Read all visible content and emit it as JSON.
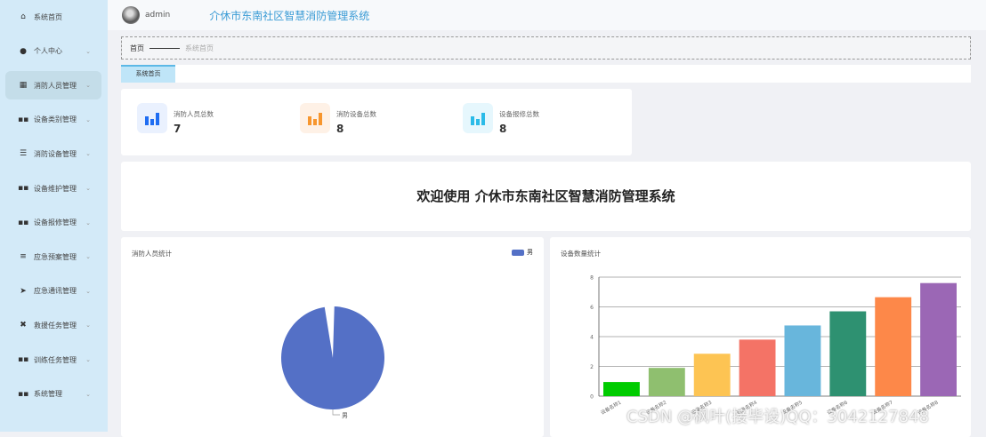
{
  "header": {
    "username": "admin",
    "title": "介休市东南社区智慧消防管理系统"
  },
  "sidebar": {
    "items": [
      {
        "label": "系统首页",
        "icon": "home-icon",
        "glyph": "⌂",
        "chev": false
      },
      {
        "label": "个人中心",
        "icon": "user-icon",
        "glyph": "●",
        "chev": true
      },
      {
        "label": "消防人员管理",
        "icon": "grid-icon",
        "glyph": "▦",
        "chev": true
      },
      {
        "label": "设备类别管理",
        "icon": "apps-icon",
        "glyph": "▪▪",
        "chev": true
      },
      {
        "label": "消防设备管理",
        "icon": "list-icon",
        "glyph": "☰",
        "chev": true
      },
      {
        "label": "设备维护管理",
        "icon": "apps-icon",
        "glyph": "▪▪",
        "chev": true
      },
      {
        "label": "设备报修管理",
        "icon": "apps-icon",
        "glyph": "▪▪",
        "chev": true
      },
      {
        "label": "应急预案管理",
        "icon": "sliders-icon",
        "glyph": "≡",
        "chev": true
      },
      {
        "label": "应急通讯管理",
        "icon": "send-icon",
        "glyph": "➤",
        "chev": true
      },
      {
        "label": "救援任务管理",
        "icon": "rescue-icon",
        "glyph": "✖",
        "chev": true
      },
      {
        "label": "训练任务管理",
        "icon": "apps-icon",
        "glyph": "▪▪",
        "chev": true
      },
      {
        "label": "系统管理",
        "icon": "apps-icon",
        "glyph": "▪▪",
        "chev": true
      }
    ]
  },
  "breadcrumb": {
    "home": "首页",
    "current": "系统首页"
  },
  "tabs": [
    "系统首页"
  ],
  "stats": [
    {
      "label": "消防人员总数",
      "value": "7",
      "color": "#1f6df2",
      "bg": "#eaf1fe"
    },
    {
      "label": "消防设备总数",
      "value": "8",
      "color": "#f7962e",
      "bg": "#fef1e6"
    },
    {
      "label": "设备报修总数",
      "value": "8",
      "color": "#2bbbe8",
      "bg": "#e6f7fd"
    }
  ],
  "welcome": "欢迎使用 介休市东南社区智慧消防管理系统",
  "watermark": "CSDN @枫叶(接毕设)QQ：3042127848",
  "chart_data": [
    {
      "type": "pie",
      "title": "消防人员统计",
      "legend": [
        "男"
      ],
      "slices": [
        {
          "name": "男",
          "value": 7
        }
      ],
      "color": "#5470c6"
    },
    {
      "type": "bar",
      "title": "设备数量统计",
      "categories": [
        "设备名称1",
        "设备名称2",
        "设备名称3",
        "设备名称4",
        "设备名称5",
        "设备名称6",
        "设备名称7",
        "设备名称8"
      ],
      "values": [
        0.95,
        1.9,
        2.85,
        3.8,
        4.75,
        5.7,
        6.65,
        7.6
      ],
      "colors": [
        "#00cc00",
        "#8fbf6f",
        "#fdc453",
        "#f47366",
        "#68b6dc",
        "#2e9171",
        "#fd8849",
        "#9b67b5"
      ],
      "ylim": [
        0,
        8
      ],
      "yticks": [
        0,
        2,
        4,
        6,
        8
      ]
    }
  ]
}
